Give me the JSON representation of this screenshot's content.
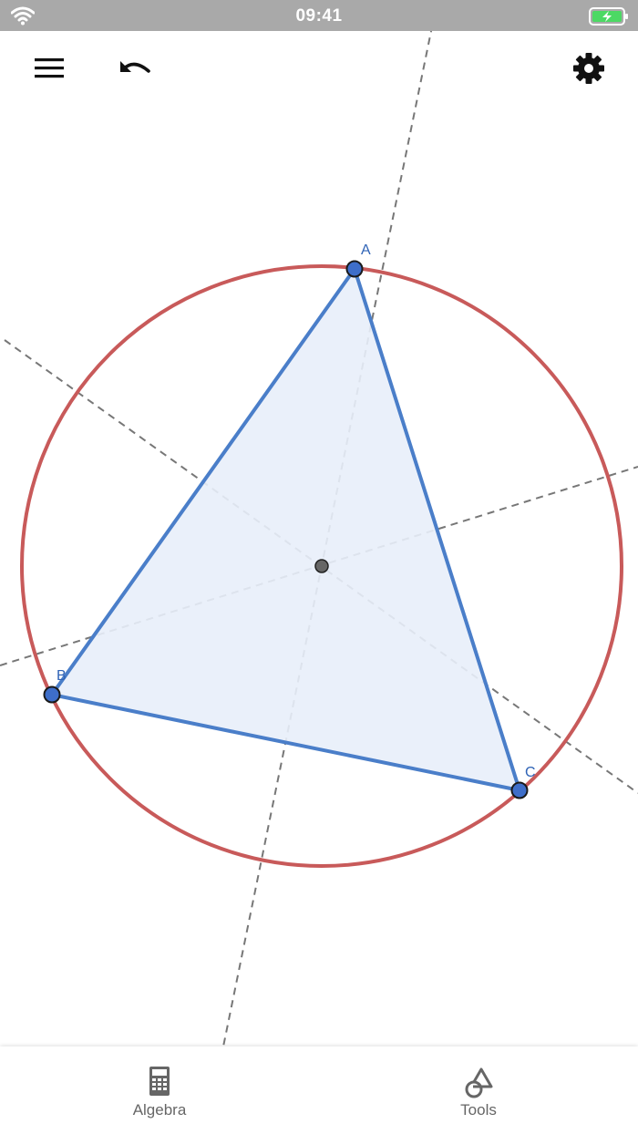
{
  "status_bar": {
    "time": "09:41"
  },
  "toolbar": {
    "menu_icon": "hamburger-menu-icon",
    "undo_icon": "undo-icon",
    "settings_icon": "gear-icon"
  },
  "construction": {
    "points": {
      "A": "A",
      "B": "B",
      "C": "C"
    },
    "colors": {
      "triangle_stroke": "#4a7ec9",
      "triangle_fill": "#e8eef9",
      "circle_stroke": "#c85a5a",
      "bisector_stroke": "#777777",
      "point_fill": "#3e6ec9",
      "center_fill": "#666666"
    }
  },
  "bottom_nav": {
    "algebra_label": "Algebra",
    "tools_label": "Tools"
  }
}
